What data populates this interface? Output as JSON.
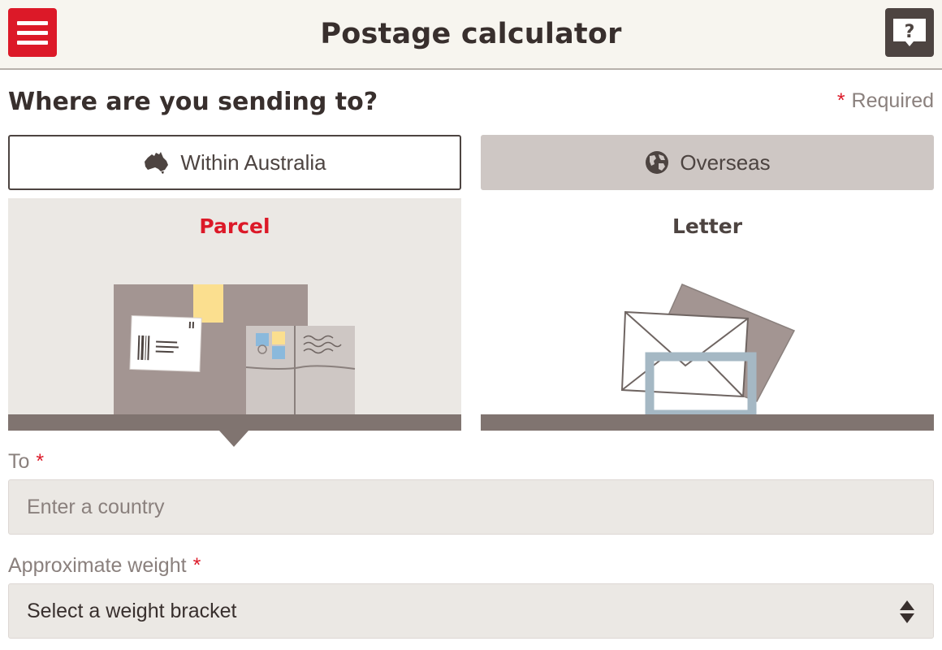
{
  "header": {
    "title": "Postage calculator"
  },
  "form": {
    "question": "Where are you sending to?",
    "required_marker": "*",
    "required_label": "Required",
    "destinations": {
      "within": "Within Australia",
      "overseas": "Overseas",
      "selected": "within"
    },
    "types": {
      "parcel": "Parcel",
      "letter": "Letter",
      "selected": "parcel"
    },
    "to": {
      "label": "To",
      "required_marker": "*",
      "placeholder": "Enter a country"
    },
    "weight": {
      "label": "Approximate weight",
      "required_marker": "*",
      "selected_value": "Select a weight bracket"
    }
  },
  "colors": {
    "brand_red": "#dc1928",
    "dark_brown": "#4d4441",
    "card_bg": "#ebe8e4",
    "base_bar": "#807470"
  },
  "icons": [
    "menu-icon",
    "help-icon",
    "australia-icon",
    "globe-icon",
    "select-arrows-icon"
  ]
}
